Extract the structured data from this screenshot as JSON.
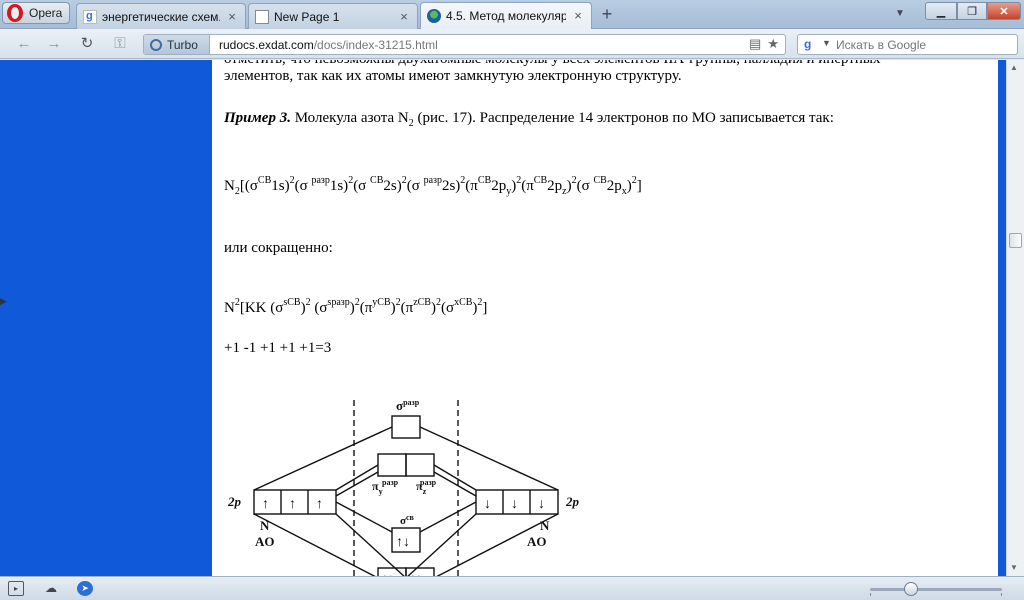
{
  "browser": {
    "menu_label": "Opera",
    "tabs": [
      {
        "title": "энергетические схем...",
        "icon": "google-favicon"
      },
      {
        "title": "New Page 1",
        "icon": "page-favicon"
      },
      {
        "title": "4.5. Метод молекуляр...",
        "icon": "exdat-favicon",
        "active": true
      }
    ],
    "turbo_label": "Turbo",
    "url_host": "rudocs.exdat.com",
    "url_path": "/docs/index-31215.html",
    "search_placeholder": "Искать в Google",
    "search_engine_letter": "g"
  },
  "page": {
    "intro_line1": "отметить, что невозможны двухатомные молекулы у всех элементов IIA-группы, палладия и инертных",
    "intro_line2": "элементов, так как их атомы имеют замкнутую электронную структуру.",
    "example_label": "Пример 3.",
    "example_text_1": " Молекула азота N",
    "example_sub": "2",
    "example_text_2": " (рис. 17). Распределение 14 электронов по МО записывается так:",
    "short_label": "или сокращенно:",
    "spins": "+1 -1 +1 +1 +1=3",
    "diagram_labels": {
      "top_mo": "σ",
      "top_mo_sup": "разр",
      "pi_anti_sup": "разр",
      "pi_y": "π",
      "pi_y_sub": "y",
      "pi_z": "π",
      "pi_z_sub": "z",
      "sigma_cb": "σ",
      "sigma_cb_sup": "св",
      "left_orbital": "2p",
      "right_orbital": "2p",
      "left_atom": "N",
      "left_ao": "AO",
      "right_atom": "N",
      "right_ao": "AO"
    }
  },
  "colors": {
    "side_panel": "#1059d9",
    "close_button": "#c5432c"
  }
}
